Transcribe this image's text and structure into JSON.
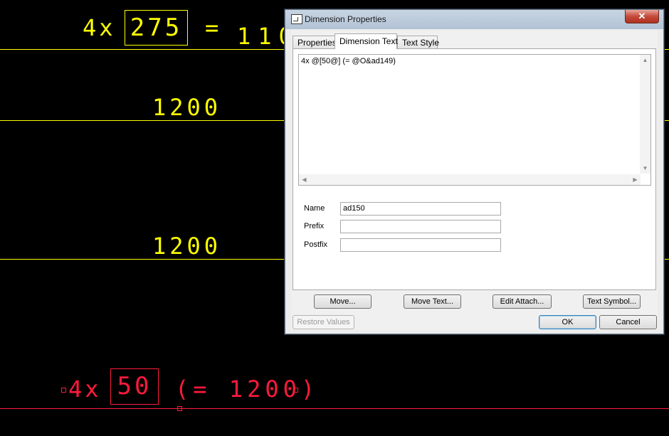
{
  "cad": {
    "top_prefix": "4x",
    "top_box_value": "275",
    "top_equals": "=",
    "top_partial": "1100",
    "dim_1": "1200",
    "dim_2": "1200",
    "red_prefix": "4x",
    "red_box_value": "50",
    "red_suffix": "(= 1200)",
    "colors": {
      "yellow": "#ffff00",
      "red": "#ff1a3c"
    }
  },
  "dialog": {
    "title": "Dimension Properties",
    "close_glyph": "✕",
    "tabs": [
      {
        "label": "Properties",
        "active": false
      },
      {
        "label": "Dimension Text",
        "active": true
      },
      {
        "label": "Text Style",
        "active": false
      }
    ],
    "text_content": "4x @[50@] (= @O&ad149)",
    "name_label": "Name",
    "name_value": "ad150",
    "prefix_label": "Prefix",
    "prefix_value": "",
    "postfix_label": "Postfix",
    "postfix_value": "",
    "buttons": {
      "move": "Move...",
      "move_text": "Move Text...",
      "edit_attach": "Edit Attach...",
      "text_symbol": "Text Symbol...",
      "restore_values": "Restore Values",
      "ok": "OK",
      "cancel": "Cancel"
    }
  }
}
